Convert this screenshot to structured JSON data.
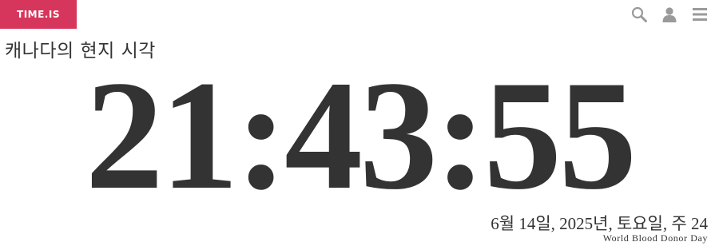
{
  "header": {
    "logo_text": "TIME.IS",
    "logo_color": "#d6365b",
    "icons": [
      "search-icon",
      "user-icon",
      "menu-icon"
    ],
    "icon_color": "#9a9a9a"
  },
  "location_title": "캐나다의 현지 시각",
  "clock": {
    "time": "21:43:55"
  },
  "date_line": "6월 14일, 2025년, 토요일, 주 24",
  "event_line": "World Blood Donor Day"
}
